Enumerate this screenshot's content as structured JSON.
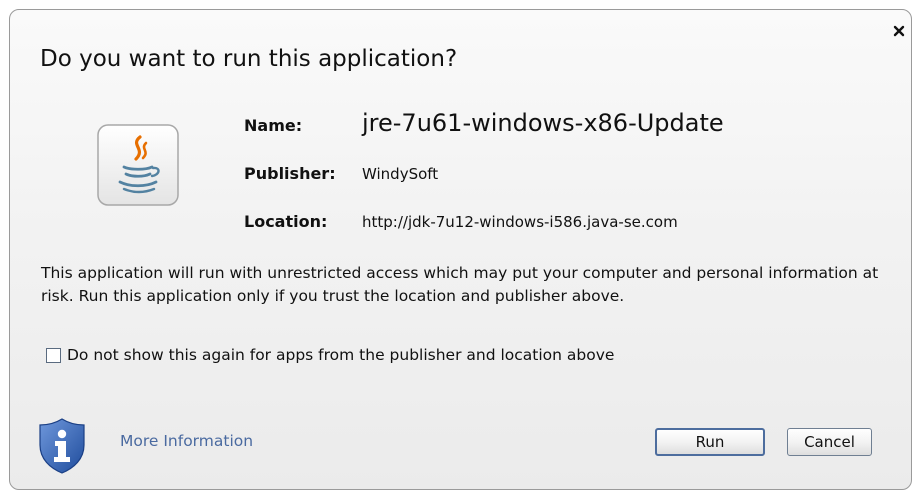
{
  "dialog": {
    "title": "Do you want to run this application?",
    "close_icon": "close-icon",
    "app_icon": "java-cup-icon",
    "fields": {
      "name_label": "Name:",
      "name_value": "jre-7u61-windows-x86-Update",
      "publisher_label": "Publisher:",
      "publisher_value": "WindySoft",
      "location_label": "Location:",
      "location_value": "http://jdk-7u12-windows-i586.java-se.com"
    },
    "warning_text": "This application will run with unrestricted access which may put your computer and personal information at risk. Run this application only if you trust the location and publisher above.",
    "checkbox": {
      "label": "Do not show this again for apps from the publisher and location above",
      "checked": false
    },
    "footer": {
      "shield_icon": "info-shield-icon",
      "more_info_label": "More Information",
      "run_label": "Run",
      "cancel_label": "Cancel"
    }
  },
  "colors": {
    "link": "#4a6aa0",
    "shield_blue": "#2e5aa8",
    "java_orange": "#e76f00",
    "java_blue": "#5382a1"
  }
}
